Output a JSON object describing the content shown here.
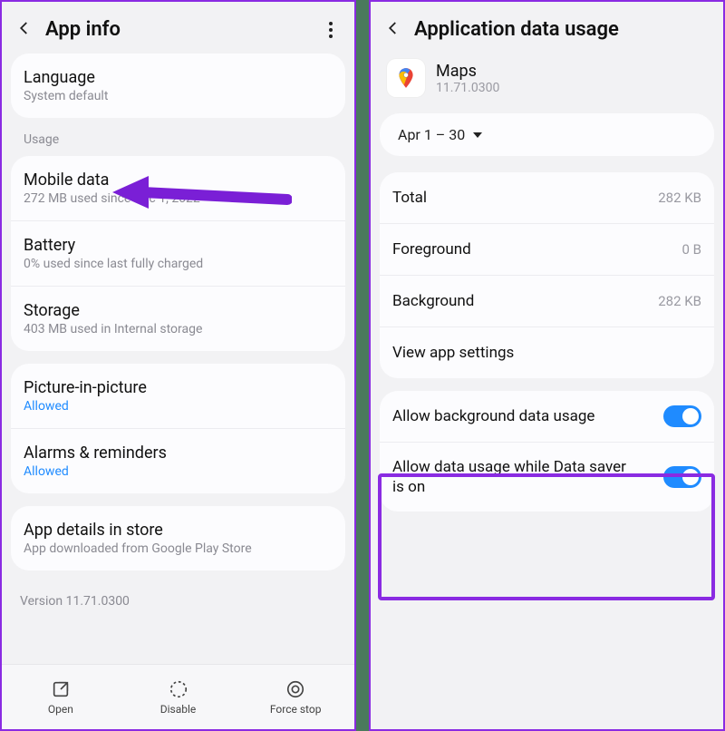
{
  "left": {
    "title": "App info",
    "rows_top": [
      {
        "title": "Language",
        "sub": "System default"
      }
    ],
    "usage_label": "Usage",
    "rows_usage": [
      {
        "title": "Mobile data",
        "sub": "272 MB used since Dec 1, 2022"
      },
      {
        "title": "Battery",
        "sub": "0% used since last fully charged"
      },
      {
        "title": "Storage",
        "sub": "403 MB used in Internal storage"
      }
    ],
    "rows_permcard": [
      {
        "title": "Picture-in-picture",
        "sub": "Allowed",
        "blue": true
      },
      {
        "title": "Alarms & reminders",
        "sub": "Allowed",
        "blue": true
      }
    ],
    "rows_store": [
      {
        "title": "App details in store",
        "sub": "App downloaded from Google Play Store"
      }
    ],
    "version": "Version 11.71.0300",
    "bottom": {
      "open": "Open",
      "disable": "Disable",
      "force": "Force stop"
    }
  },
  "right": {
    "title": "Application data usage",
    "app_name": "Maps",
    "app_ver": "11.71.0300",
    "date_range": "Apr 1 – 30",
    "stats": [
      {
        "label": "Total",
        "value": "282 KB"
      },
      {
        "label": "Foreground",
        "value": "0 B"
      },
      {
        "label": "Background",
        "value": "282 KB"
      }
    ],
    "view_settings": "View app settings",
    "toggles": [
      {
        "label": "Allow background data usage",
        "on": true
      },
      {
        "label": "Allow data usage while Data saver is on",
        "on": true
      }
    ]
  }
}
